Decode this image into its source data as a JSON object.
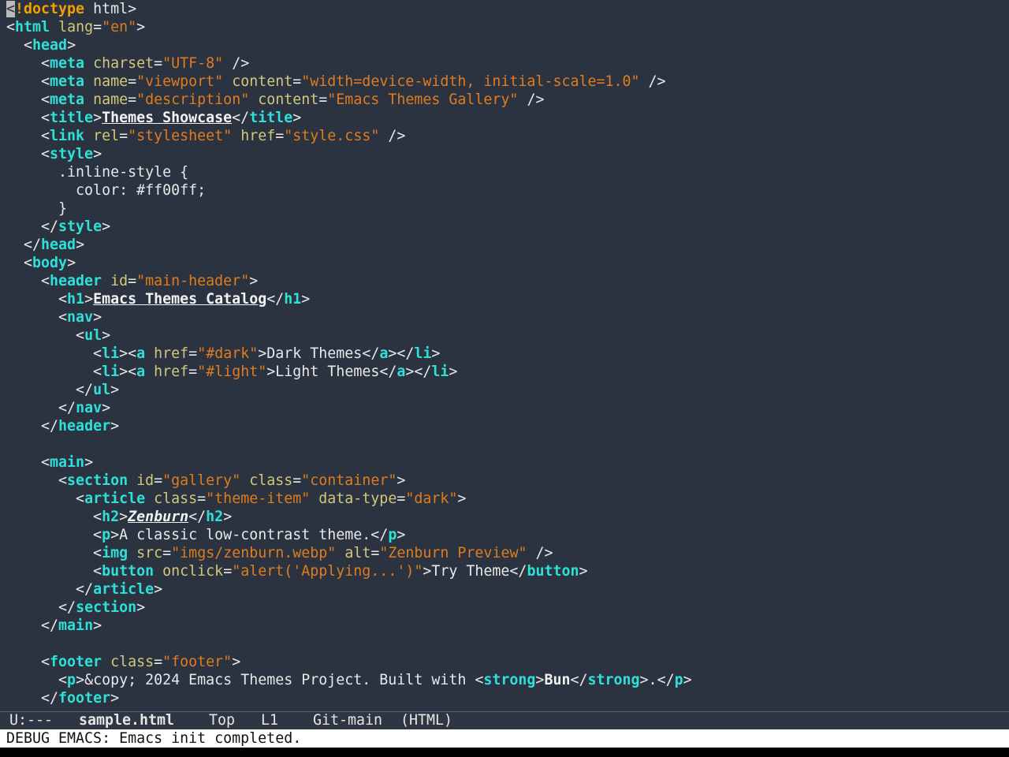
{
  "editor": {
    "lines": [
      [
        [
          "cursor",
          "<"
        ],
        [
          "kw",
          "!doctype"
        ],
        [
          "t",
          " html>"
        ]
      ],
      [
        [
          "t",
          "<"
        ],
        [
          "tag",
          "html"
        ],
        [
          "t",
          " "
        ],
        [
          "attr",
          "lang"
        ],
        [
          "t",
          "="
        ],
        [
          "str",
          "\"en\""
        ],
        [
          "t",
          ">"
        ]
      ],
      [
        [
          "t",
          "  <"
        ],
        [
          "tag",
          "head"
        ],
        [
          "t",
          ">"
        ]
      ],
      [
        [
          "t",
          "    <"
        ],
        [
          "tag",
          "meta"
        ],
        [
          "t",
          " "
        ],
        [
          "attr",
          "charset"
        ],
        [
          "t",
          "="
        ],
        [
          "str",
          "\"UTF-8\""
        ],
        [
          "t",
          " />"
        ]
      ],
      [
        [
          "t",
          "    <"
        ],
        [
          "tag",
          "meta"
        ],
        [
          "t",
          " "
        ],
        [
          "attr",
          "name"
        ],
        [
          "t",
          "="
        ],
        [
          "str",
          "\"viewport\""
        ],
        [
          "t",
          " "
        ],
        [
          "attr",
          "content"
        ],
        [
          "t",
          "="
        ],
        [
          "str",
          "\"width=device-width, initial-scale=1.0\""
        ],
        [
          "t",
          " />"
        ]
      ],
      [
        [
          "t",
          "    <"
        ],
        [
          "tag",
          "meta"
        ],
        [
          "t",
          " "
        ],
        [
          "attr",
          "name"
        ],
        [
          "t",
          "="
        ],
        [
          "str",
          "\"description\""
        ],
        [
          "t",
          " "
        ],
        [
          "attr",
          "content"
        ],
        [
          "t",
          "="
        ],
        [
          "str",
          "\"Emacs Themes Gallery\""
        ],
        [
          "t",
          " />"
        ]
      ],
      [
        [
          "t",
          "    <"
        ],
        [
          "tag",
          "title"
        ],
        [
          "t",
          ">"
        ],
        [
          "titletxt",
          "Themes Showcase"
        ],
        [
          "t",
          "</"
        ],
        [
          "tag",
          "title"
        ],
        [
          "t",
          ">"
        ]
      ],
      [
        [
          "t",
          "    <"
        ],
        [
          "tag",
          "link"
        ],
        [
          "t",
          " "
        ],
        [
          "attr",
          "rel"
        ],
        [
          "t",
          "="
        ],
        [
          "str",
          "\"stylesheet\""
        ],
        [
          "t",
          " "
        ],
        [
          "attr",
          "href"
        ],
        [
          "t",
          "="
        ],
        [
          "str",
          "\"style.css\""
        ],
        [
          "t",
          " />"
        ]
      ],
      [
        [
          "t",
          "    <"
        ],
        [
          "tag",
          "style"
        ],
        [
          "t",
          ">"
        ]
      ],
      [
        [
          "txt",
          "      .inline-style {"
        ]
      ],
      [
        [
          "txt",
          "        color: #ff00ff;"
        ]
      ],
      [
        [
          "txt",
          "      }"
        ]
      ],
      [
        [
          "t",
          "    </"
        ],
        [
          "tag",
          "style"
        ],
        [
          "t",
          ">"
        ]
      ],
      [
        [
          "t",
          "  </"
        ],
        [
          "tag",
          "head"
        ],
        [
          "t",
          ">"
        ]
      ],
      [
        [
          "t",
          "  <"
        ],
        [
          "tag",
          "body"
        ],
        [
          "t",
          ">"
        ]
      ],
      [
        [
          "t",
          "    <"
        ],
        [
          "tag",
          "header"
        ],
        [
          "t",
          " "
        ],
        [
          "attr",
          "id"
        ],
        [
          "t",
          "="
        ],
        [
          "str",
          "\"main-header\""
        ],
        [
          "t",
          ">"
        ]
      ],
      [
        [
          "t",
          "      <"
        ],
        [
          "tag",
          "h1"
        ],
        [
          "t",
          ">"
        ],
        [
          "titletxt",
          "Emacs Themes Catalog"
        ],
        [
          "t",
          "</"
        ],
        [
          "tag",
          "h1"
        ],
        [
          "t",
          ">"
        ]
      ],
      [
        [
          "t",
          "      <"
        ],
        [
          "tag",
          "nav"
        ],
        [
          "t",
          ">"
        ]
      ],
      [
        [
          "t",
          "        <"
        ],
        [
          "tag",
          "ul"
        ],
        [
          "t",
          ">"
        ]
      ],
      [
        [
          "t",
          "          <"
        ],
        [
          "tag",
          "li"
        ],
        [
          "t",
          "><"
        ],
        [
          "tag",
          "a"
        ],
        [
          "t",
          " "
        ],
        [
          "attr",
          "href"
        ],
        [
          "t",
          "="
        ],
        [
          "str",
          "\"#dark\""
        ],
        [
          "t",
          ">"
        ],
        [
          "txt",
          "Dark Themes"
        ],
        [
          "t",
          "</"
        ],
        [
          "tag",
          "a"
        ],
        [
          "t",
          "></"
        ],
        [
          "tag",
          "li"
        ],
        [
          "t",
          ">"
        ]
      ],
      [
        [
          "t",
          "          <"
        ],
        [
          "tag",
          "li"
        ],
        [
          "t",
          "><"
        ],
        [
          "tag",
          "a"
        ],
        [
          "t",
          " "
        ],
        [
          "attr",
          "href"
        ],
        [
          "t",
          "="
        ],
        [
          "str",
          "\"#light\""
        ],
        [
          "t",
          ">"
        ],
        [
          "txt",
          "Light Themes"
        ],
        [
          "t",
          "</"
        ],
        [
          "tag",
          "a"
        ],
        [
          "t",
          "></"
        ],
        [
          "tag",
          "li"
        ],
        [
          "t",
          ">"
        ]
      ],
      [
        [
          "t",
          "        </"
        ],
        [
          "tag",
          "ul"
        ],
        [
          "t",
          ">"
        ]
      ],
      [
        [
          "t",
          "      </"
        ],
        [
          "tag",
          "nav"
        ],
        [
          "t",
          ">"
        ]
      ],
      [
        [
          "t",
          "    </"
        ],
        [
          "tag",
          "header"
        ],
        [
          "t",
          ">"
        ]
      ],
      [
        [
          "t",
          ""
        ]
      ],
      [
        [
          "t",
          "    <"
        ],
        [
          "tag",
          "main"
        ],
        [
          "t",
          ">"
        ]
      ],
      [
        [
          "t",
          "      <"
        ],
        [
          "tag",
          "section"
        ],
        [
          "t",
          " "
        ],
        [
          "attr",
          "id"
        ],
        [
          "t",
          "="
        ],
        [
          "str",
          "\"gallery\""
        ],
        [
          "t",
          " "
        ],
        [
          "attr",
          "class"
        ],
        [
          "t",
          "="
        ],
        [
          "str",
          "\"container\""
        ],
        [
          "t",
          ">"
        ]
      ],
      [
        [
          "t",
          "        <"
        ],
        [
          "tag",
          "article"
        ],
        [
          "t",
          " "
        ],
        [
          "attr",
          "class"
        ],
        [
          "t",
          "="
        ],
        [
          "str",
          "\"theme-item\""
        ],
        [
          "t",
          " "
        ],
        [
          "attr",
          "data-type"
        ],
        [
          "t",
          "="
        ],
        [
          "str",
          "\"dark\""
        ],
        [
          "t",
          ">"
        ]
      ],
      [
        [
          "t",
          "          <"
        ],
        [
          "tag",
          "h2"
        ],
        [
          "t",
          ">"
        ],
        [
          "h2txt",
          "Zenburn"
        ],
        [
          "t",
          "</"
        ],
        [
          "tag",
          "h2"
        ],
        [
          "t",
          ">"
        ]
      ],
      [
        [
          "t",
          "          <"
        ],
        [
          "tag",
          "p"
        ],
        [
          "t",
          ">"
        ],
        [
          "txt",
          "A classic low-contrast theme."
        ],
        [
          "t",
          "</"
        ],
        [
          "tag",
          "p"
        ],
        [
          "t",
          ">"
        ]
      ],
      [
        [
          "t",
          "          <"
        ],
        [
          "tag",
          "img"
        ],
        [
          "t",
          " "
        ],
        [
          "attr",
          "src"
        ],
        [
          "t",
          "="
        ],
        [
          "str",
          "\"imgs/zenburn.webp\""
        ],
        [
          "t",
          " "
        ],
        [
          "attr",
          "alt"
        ],
        [
          "t",
          "="
        ],
        [
          "str",
          "\"Zenburn Preview\""
        ],
        [
          "t",
          " />"
        ]
      ],
      [
        [
          "t",
          "          <"
        ],
        [
          "tag",
          "button"
        ],
        [
          "t",
          " "
        ],
        [
          "attr",
          "onclick"
        ],
        [
          "t",
          "="
        ],
        [
          "str",
          "\"alert('Applying...')\""
        ],
        [
          "t",
          ">"
        ],
        [
          "txt",
          "Try Theme"
        ],
        [
          "t",
          "</"
        ],
        [
          "tag",
          "button"
        ],
        [
          "t",
          ">"
        ]
      ],
      [
        [
          "t",
          "        </"
        ],
        [
          "tag",
          "article"
        ],
        [
          "t",
          ">"
        ]
      ],
      [
        [
          "t",
          "      </"
        ],
        [
          "tag",
          "section"
        ],
        [
          "t",
          ">"
        ]
      ],
      [
        [
          "t",
          "    </"
        ],
        [
          "tag",
          "main"
        ],
        [
          "t",
          ">"
        ]
      ],
      [
        [
          "t",
          ""
        ]
      ],
      [
        [
          "t",
          "    <"
        ],
        [
          "tag",
          "footer"
        ],
        [
          "t",
          " "
        ],
        [
          "attr",
          "class"
        ],
        [
          "t",
          "="
        ],
        [
          "str",
          "\"footer\""
        ],
        [
          "t",
          ">"
        ]
      ],
      [
        [
          "t",
          "      <"
        ],
        [
          "tag",
          "p"
        ],
        [
          "t",
          ">"
        ],
        [
          "txt",
          "&copy; 2024 Emacs Themes Project. Built with "
        ],
        [
          "t",
          "<"
        ],
        [
          "tag",
          "strong"
        ],
        [
          "t",
          ">"
        ],
        [
          "strongtxt",
          "Bun"
        ],
        [
          "t",
          "</"
        ],
        [
          "tag",
          "strong"
        ],
        [
          "t",
          ">"
        ],
        [
          "txt",
          "."
        ],
        [
          "t",
          "</"
        ],
        [
          "tag",
          "p"
        ],
        [
          "t",
          ">"
        ]
      ],
      [
        [
          "t",
          "    </"
        ],
        [
          "tag",
          "footer"
        ],
        [
          "t",
          ">"
        ]
      ]
    ]
  },
  "modeline": {
    "status": "U:---",
    "filename": "sample.html",
    "position": "Top",
    "line": "L1",
    "vc": "Git-main",
    "mode": "(HTML)"
  },
  "echo_area": {
    "message": "DEBUG EMACS: Emacs init completed."
  },
  "colors": {
    "background": "#2b3340",
    "tag": "#2ee0d8",
    "keyword": "#f0a000",
    "attribute": "#d2c87a",
    "string": "#e07b1e",
    "text": "#e8e8e8"
  }
}
